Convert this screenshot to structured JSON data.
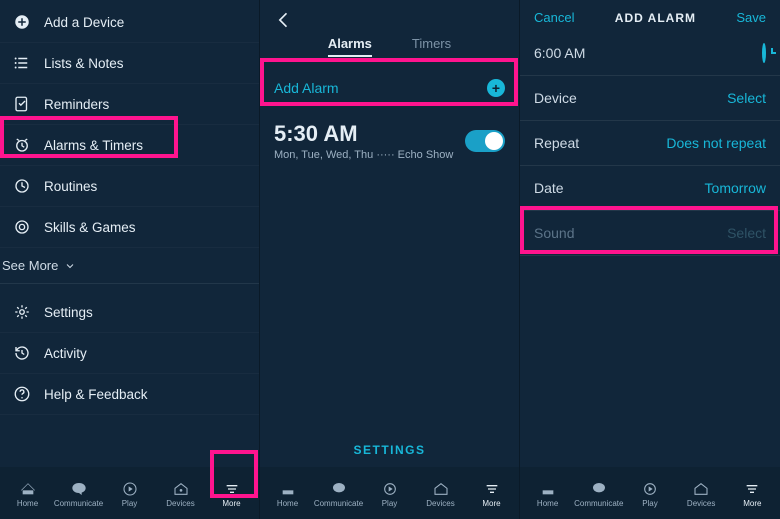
{
  "screen1": {
    "menu": [
      {
        "id": "add-device",
        "label": "Add a Device",
        "icon": "plus-circle"
      },
      {
        "id": "lists-notes",
        "label": "Lists & Notes",
        "icon": "list"
      },
      {
        "id": "reminders",
        "label": "Reminders",
        "icon": "flag"
      },
      {
        "id": "alarms-timers",
        "label": "Alarms & Timers",
        "icon": "alarm"
      },
      {
        "id": "routines",
        "label": "Routines",
        "icon": "routine"
      },
      {
        "id": "skills-games",
        "label": "Skills & Games",
        "icon": "target"
      }
    ],
    "see_more": "See More",
    "menu2": [
      {
        "id": "settings",
        "label": "Settings",
        "icon": "gear"
      },
      {
        "id": "activity",
        "label": "Activity",
        "icon": "history"
      },
      {
        "id": "help-feedback",
        "label": "Help & Feedback",
        "icon": "help"
      }
    ]
  },
  "screen2": {
    "tabs": {
      "alarms": "Alarms",
      "timers": "Timers",
      "active": "alarms"
    },
    "add_alarm": "Add Alarm",
    "alarm": {
      "time": "5:30 AM",
      "sub": "Mon, Tue, Wed, Thu ····· Echo Show",
      "enabled": true
    },
    "settings_link": "SETTINGS"
  },
  "screen3": {
    "header": {
      "cancel": "Cancel",
      "title": "ADD ALARM",
      "save": "Save"
    },
    "rows": {
      "time": {
        "label": "6:00 AM",
        "value_icon": "clock"
      },
      "device": {
        "label": "Device",
        "value": "Select"
      },
      "repeat": {
        "label": "Repeat",
        "value": "Does not repeat"
      },
      "date": {
        "label": "Date",
        "value": "Tomorrow"
      },
      "sound": {
        "label": "Sound",
        "value": "Select"
      }
    }
  },
  "nav": {
    "items": [
      {
        "id": "home",
        "label": "Home"
      },
      {
        "id": "communicate",
        "label": "Communicate"
      },
      {
        "id": "play",
        "label": "Play"
      },
      {
        "id": "devices",
        "label": "Devices"
      },
      {
        "id": "more",
        "label": "More"
      }
    ]
  }
}
